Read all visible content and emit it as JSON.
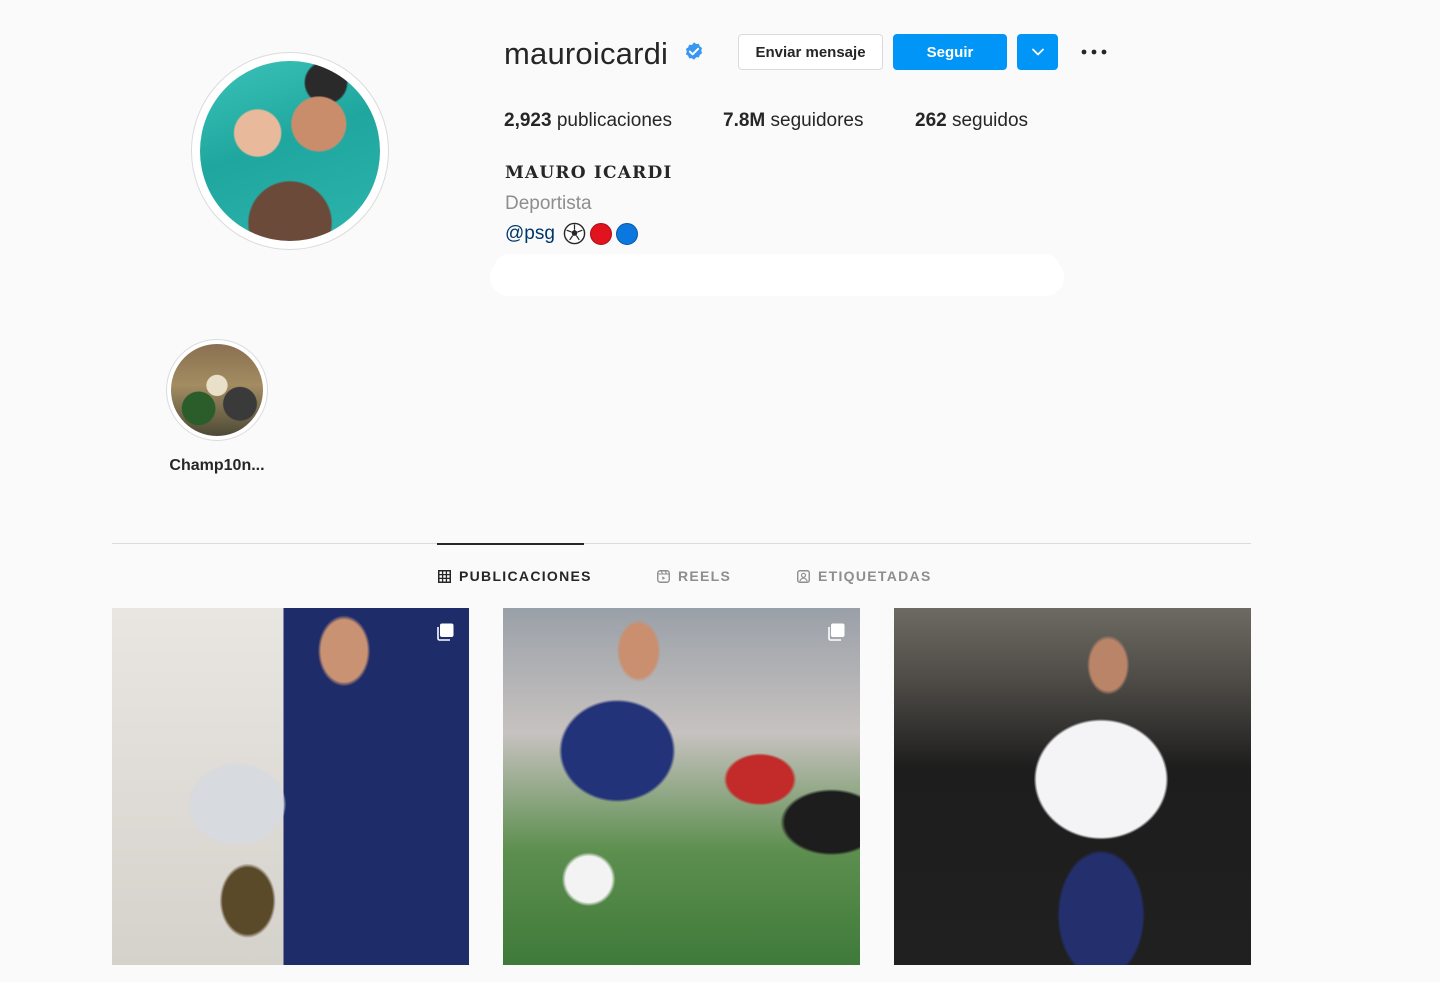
{
  "profile": {
    "username": "mauroicardi",
    "full_name": "MAURO ICARDI",
    "category": "Deportista",
    "bio_mention": "@psg",
    "bio_emojis": [
      "soccer-ball-icon",
      "red-circle-icon",
      "blue-circle-icon"
    ]
  },
  "actions": {
    "message_label": "Enviar mensaje",
    "follow_label": "Seguir"
  },
  "stats": {
    "posts_count": "2,923",
    "posts_label": "publicaciones",
    "followers_count": "7.8M",
    "followers_label": "seguidores",
    "following_count": "262",
    "following_label": "seguidos"
  },
  "highlights": [
    {
      "label": "Champ10n..."
    }
  ],
  "tabs": [
    {
      "label": "PUBLICACIONES",
      "icon": "grid-icon",
      "active": true
    },
    {
      "label": "REELS",
      "icon": "reels-icon",
      "active": false
    },
    {
      "label": "ETIQUETADAS",
      "icon": "tagged-icon",
      "active": false
    }
  ],
  "posts": [
    {
      "icon": "carousel-icon"
    },
    {
      "icon": "carousel-icon"
    },
    {
      "icon": null
    }
  ],
  "colors": {
    "accent": "#0095f6",
    "text": "#262626",
    "muted": "#8e8e8e",
    "border": "#dbdbdb",
    "background": "#fafafa",
    "verified": "#3897f0"
  }
}
